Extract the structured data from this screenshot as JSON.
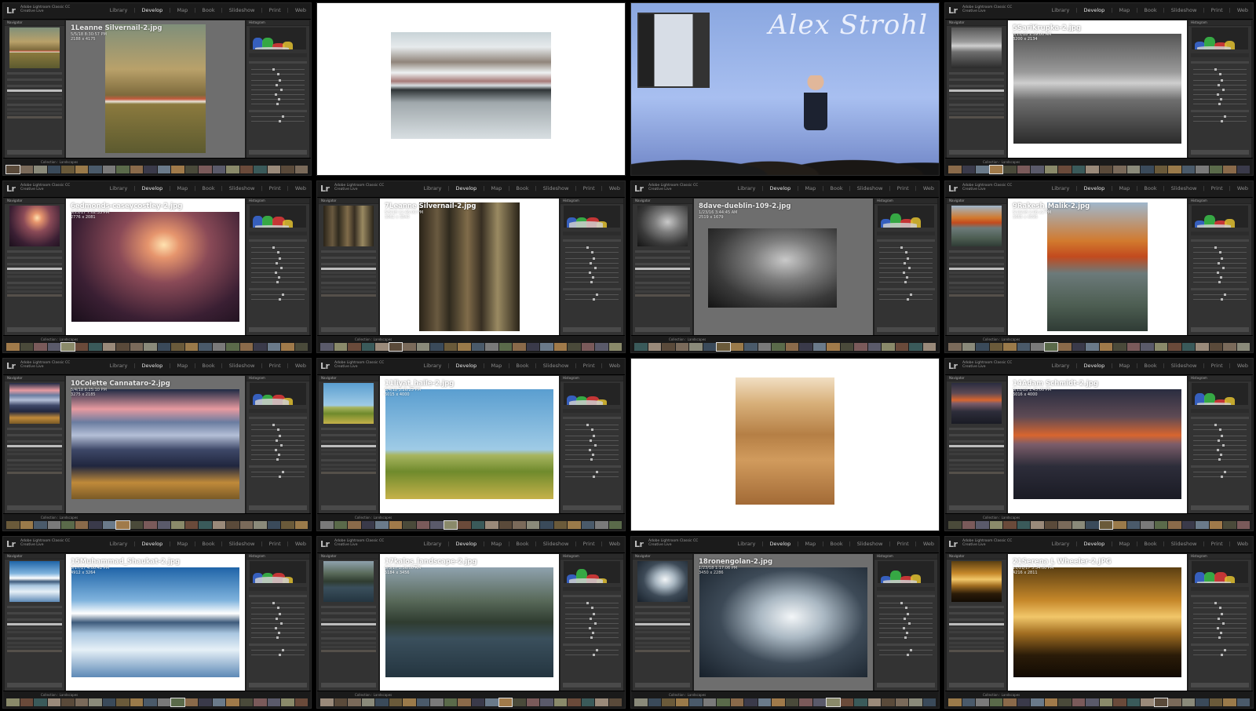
{
  "lightroom": {
    "logo": "Lr",
    "catalog_line1": "Adobe Lightroom Classic CC",
    "catalog_line2": "Creative Live",
    "modules": [
      "Library",
      "Develop",
      "Map",
      "Book",
      "Slideshow",
      "Print",
      "Web"
    ],
    "active_module": "Develop"
  },
  "panels": {
    "navigator": "Navigator",
    "histogram": "Histogram",
    "presets": "Presets",
    "snapshots": "Snapshots",
    "history": "History",
    "collections": "Collections"
  },
  "colors": {
    "accent_active": "#e6e6e6",
    "module_inactive": "#8a8a8a",
    "panel_bg": "#333333"
  },
  "tiles": [
    {
      "type": "lr",
      "filename": "1Leanne Silvernail-2.jpg",
      "date": "5/5/18 8:30:57 PM",
      "dims": "2188 x 4175",
      "path": "Collection : Landscapes",
      "center_bg": "gray",
      "photo": "mountain-building"
    },
    {
      "type": "image",
      "photo": "mountain-reflection"
    },
    {
      "type": "stage",
      "sign": "Alex Strohl",
      "photo": "classroom"
    },
    {
      "type": "lr",
      "filename": "5SariKrupka-2.jpg",
      "date": "5/11/18 1:59:00 AM",
      "dims": "3200 x 2134",
      "path": "Collection : Landscapes",
      "center_bg": "white",
      "photo": "bw-seascape"
    },
    {
      "type": "lr",
      "filename": "6edmonds-caseycostley-2.jpg",
      "date": "3/25/17 7:02:33 PM",
      "dims": "2776 x 2081",
      "path": "Collection : Landscapes",
      "center_bg": "white",
      "photo": "sunset-lake"
    },
    {
      "type": "lr",
      "filename": "7Leanne Silvernail-2.jpg",
      "date": "5/5/18 12:46:00 PM",
      "dims": "3062 x 3840",
      "path": "Collection : Landscapes",
      "center_bg": "white",
      "photo": "forest-tree"
    },
    {
      "type": "lr",
      "filename": "8dave-dueblin-109-2.jpg",
      "date": "1/23/16 3:44:45 AM",
      "dims": "2519 x 1679",
      "path": "Collection : Landscapes",
      "center_bg": "gray",
      "photo": "mono-mountain"
    },
    {
      "type": "lr",
      "filename": "9Rakesh_Malik-2.jpg",
      "date": "5/10/18 2:08:22 PM",
      "dims": "3665 x 4096",
      "path": "Collection : Landscapes",
      "center_bg": "white",
      "photo": "autumn-road"
    },
    {
      "type": "lr",
      "filename": "10Colette Cannataro-2.jpg",
      "date": "5/4/18 8:25:10 PM",
      "dims": "3275 x 2185",
      "path": "Collection : Landscapes",
      "center_bg": "gray",
      "photo": "dunes-mountain"
    },
    {
      "type": "lr",
      "filename": "11liyat_haile-2.jpg",
      "date": "6/4/18 3:26:25 PM",
      "dims": "6015 x 4000",
      "path": "Collection : Landscapes",
      "center_bg": "white",
      "photo": "green-hills"
    },
    {
      "type": "image",
      "photo": "desert-tracks"
    },
    {
      "type": "lr",
      "filename": "14Adam Schmidt-2.jpg",
      "date": "5/11/18 1:45:00 PM",
      "dims": "6016 x 4000",
      "path": "Collection : Landscapes",
      "center_bg": "white",
      "photo": "sunset-shore"
    },
    {
      "type": "lr",
      "filename": "15Muhammad_Shaukat-2.jpg",
      "date": "5/17/17 4:00:42 PM",
      "dims": "4912 x 3264",
      "path": "Collection : Landscapes",
      "center_bg": "white",
      "photo": "lake-mountains"
    },
    {
      "type": "lr",
      "filename": "17kalos_landscape-2.jpg",
      "date": "8/3/17 1:36:00 AM",
      "dims": "5184 x 3456",
      "path": "Collection : Landscapes",
      "center_bg": "white",
      "photo": "mountain-lake"
    },
    {
      "type": "lr",
      "filename": "18ronengolan-2.jpg",
      "date": "1/23/18 1:17:06 PM",
      "dims": "3450 x 2286",
      "path": "Collection : Landscapes",
      "center_bg": "gray",
      "photo": "snow-peak"
    },
    {
      "type": "lr",
      "filename": "21Serena L Wheeler-2.JPG",
      "date": "11/21/17 3:34:00 PM",
      "dims": "4216 x 2811",
      "path": "Collection : Landscapes",
      "center_bg": "white",
      "photo": "golden-forest"
    }
  ]
}
